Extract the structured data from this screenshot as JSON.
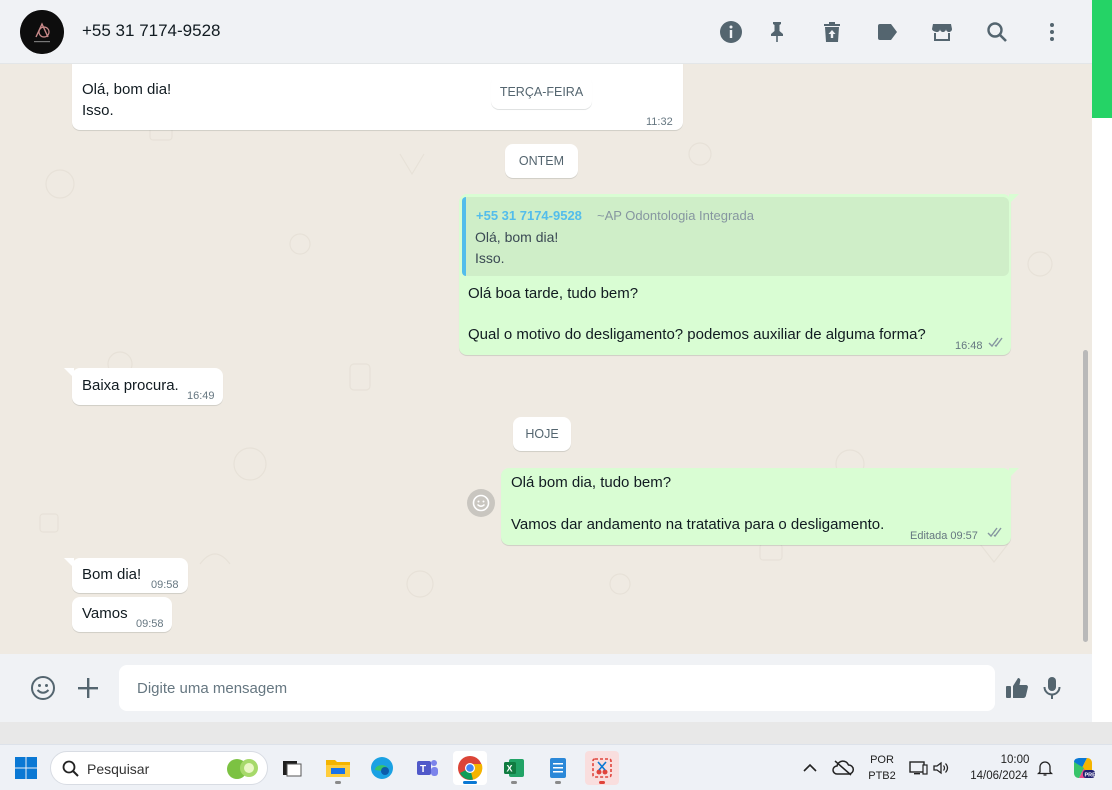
{
  "header": {
    "contact": "+55 31 7174-9528",
    "icons": [
      "info-icon",
      "pin-icon",
      "delete-icon",
      "label-icon",
      "store-icon",
      "search-icon",
      "menu-icon"
    ]
  },
  "messages": {
    "m1": {
      "line1": "Olá, bom dia!",
      "line2": "Isso.",
      "time": "11:32"
    },
    "date1": "TERÇA-FEIRA",
    "date2": "ONTEM",
    "m2": {
      "quote_author": "+55 31 7174-9528",
      "quote_group": "~AP Odontologia Integrada",
      "quote_line1": "Olá, bom dia!",
      "quote_line2": "Isso.",
      "line1": "Olá boa tarde, tudo bem?",
      "line2": "Qual o motivo do desligamento? podemos auxiliar de alguma forma?",
      "time": "16:48"
    },
    "m3": {
      "text": "Baixa procura.",
      "time": "16:49"
    },
    "date3": "HOJE",
    "m4": {
      "line1": "Olá bom dia, tudo bem?",
      "line2": "Vamos dar andamento na tratativa para o desligamento.",
      "time": "Editada 09:57"
    },
    "m5": {
      "text": "Bom dia!",
      "time": "09:58"
    },
    "m6": {
      "text": "Vamos",
      "time": "09:58"
    }
  },
  "composer": {
    "placeholder": "Digite uma mensagem"
  },
  "taskbar": {
    "search": "Pesquisar",
    "lang1": "POR",
    "lang2": "PTB2",
    "clock_time": "10:00",
    "clock_date": "14/06/2024"
  },
  "colors": {
    "accent": "#25d366",
    "outgoing": "#d9fdd3",
    "incoming": "#ffffff",
    "chat_bg": "#efeae2",
    "quote": "#53bdeb"
  }
}
